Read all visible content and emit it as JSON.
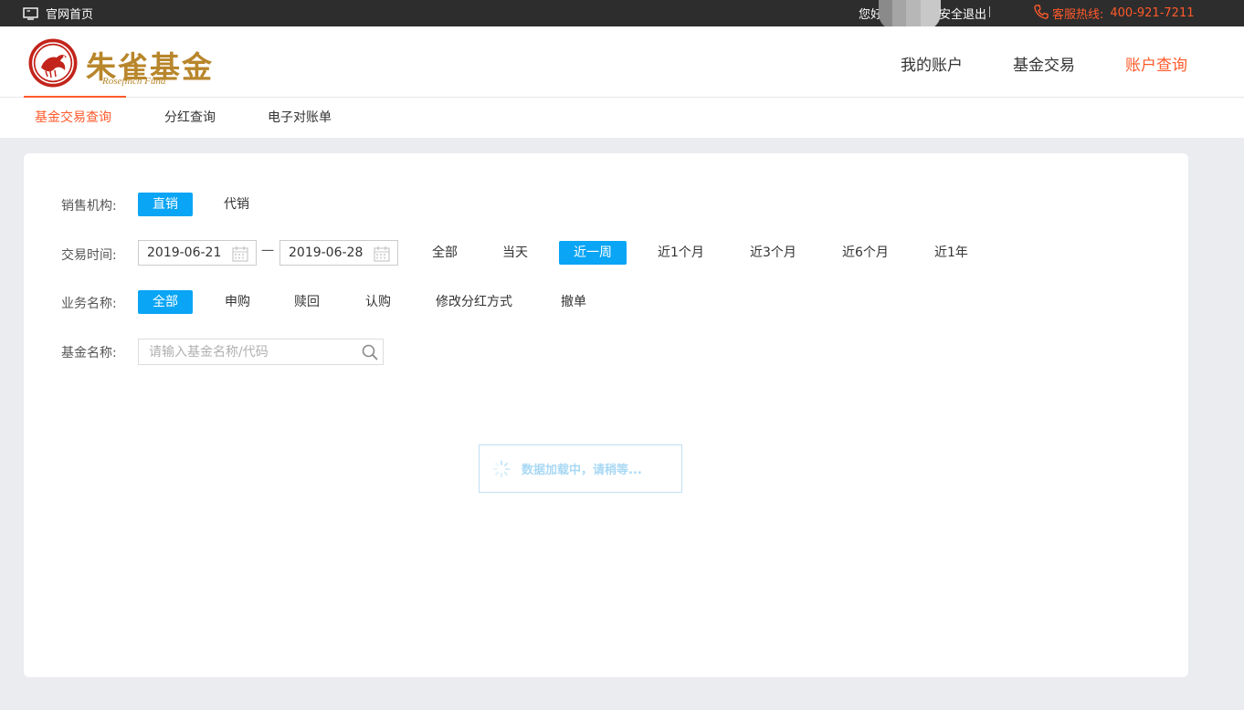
{
  "topbar": {
    "home_label": "官网首页",
    "greeting": "您好",
    "logout": "安全退出",
    "hotline_label": "客服热线:",
    "hotline_number": "400-921-7211"
  },
  "brand": {
    "name_cn": "朱雀基金",
    "name_en": "Rosefinch Fund",
    "color": "#b8862b",
    "seal_color": "#c2241b"
  },
  "main_nav": [
    {
      "label": "我的账户",
      "active": false
    },
    {
      "label": "基金交易",
      "active": false
    },
    {
      "label": "账户查询",
      "active": true
    }
  ],
  "sub_nav": [
    {
      "label": "基金交易查询",
      "active": true
    },
    {
      "label": "分红查询",
      "active": false
    },
    {
      "label": "电子对账单",
      "active": false
    }
  ],
  "filters": {
    "sales_org": {
      "label": "销售机构:",
      "options": [
        {
          "label": "直销",
          "selected": true
        },
        {
          "label": "代销",
          "selected": false
        }
      ]
    },
    "trade_time": {
      "label": "交易时间:",
      "start_date": "2019-06-21",
      "end_date": "2019-06-28",
      "separator": "一",
      "options": [
        {
          "label": "全部",
          "selected": false
        },
        {
          "label": "当天",
          "selected": false
        },
        {
          "label": "近一周",
          "selected": true
        },
        {
          "label": "近1个月",
          "selected": false
        },
        {
          "label": "近3个月",
          "selected": false
        },
        {
          "label": "近6个月",
          "selected": false
        },
        {
          "label": "近1年",
          "selected": false
        }
      ]
    },
    "business": {
      "label": "业务名称:",
      "options": [
        {
          "label": "全部",
          "selected": true
        },
        {
          "label": "申购",
          "selected": false
        },
        {
          "label": "赎回",
          "selected": false
        },
        {
          "label": "认购",
          "selected": false
        },
        {
          "label": "修改分红方式",
          "selected": false
        },
        {
          "label": "撤单",
          "selected": false
        }
      ]
    },
    "fund_name": {
      "label": "基金名称:",
      "placeholder": "请输入基金名称/代码",
      "value": ""
    }
  },
  "loading_text": "数据加载中，请稍等...",
  "colors": {
    "accent": "#ff5a2b",
    "selected_bg": "#0aa5f5",
    "topbar_bg": "#2d2d2d",
    "page_bg": "#ebecf0"
  }
}
